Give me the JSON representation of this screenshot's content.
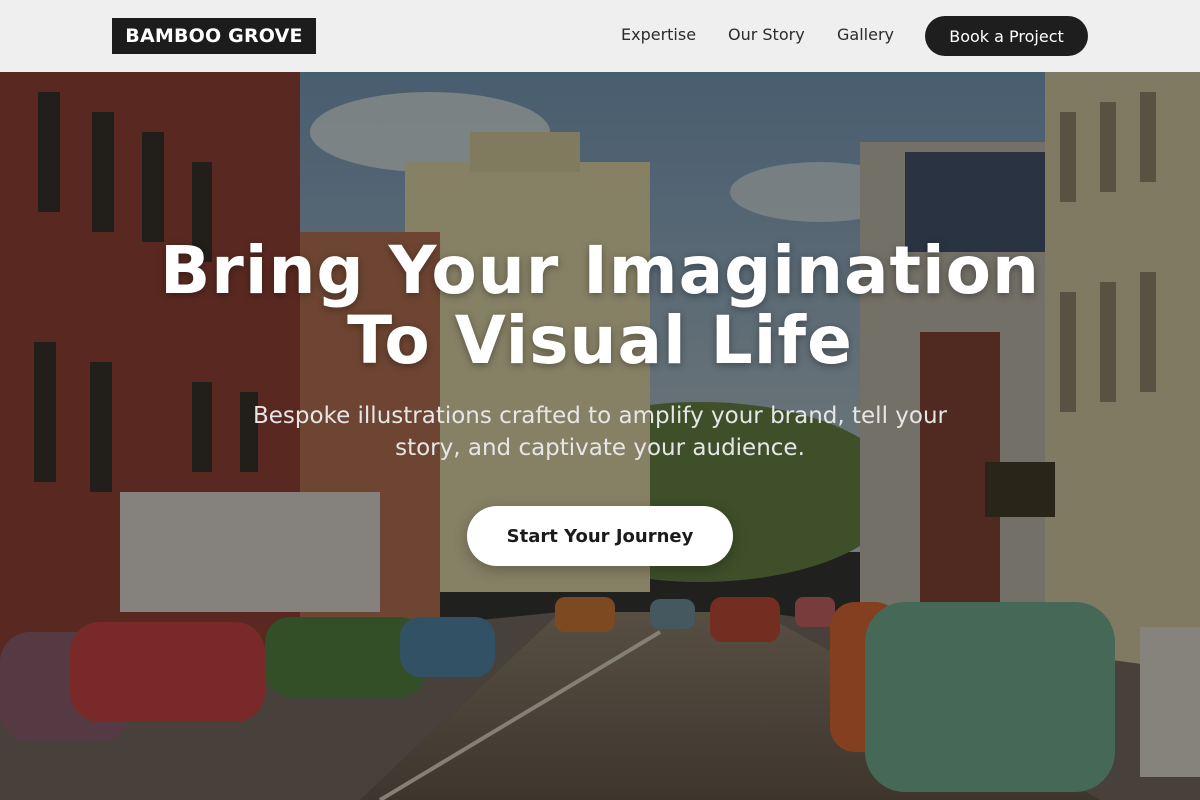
{
  "brand": {
    "name": "BAMBOO GROVE"
  },
  "nav": {
    "items": [
      {
        "label": "Expertise"
      },
      {
        "label": "Our Story"
      },
      {
        "label": "Gallery"
      }
    ],
    "cta_label": "Book a Project"
  },
  "hero": {
    "title_line1": "Bring Your Imagination",
    "title_line2": "To Visual Life",
    "subtitle": "Bespoke illustrations crafted to amplify your brand, tell your story, and captivate your audience.",
    "cta_label": "Start Your Journey"
  },
  "colors": {
    "header_bg": "#efefef",
    "logo_bg": "#1c1c1c",
    "button_dark": "#1e1e1e",
    "button_light": "#ffffff"
  }
}
